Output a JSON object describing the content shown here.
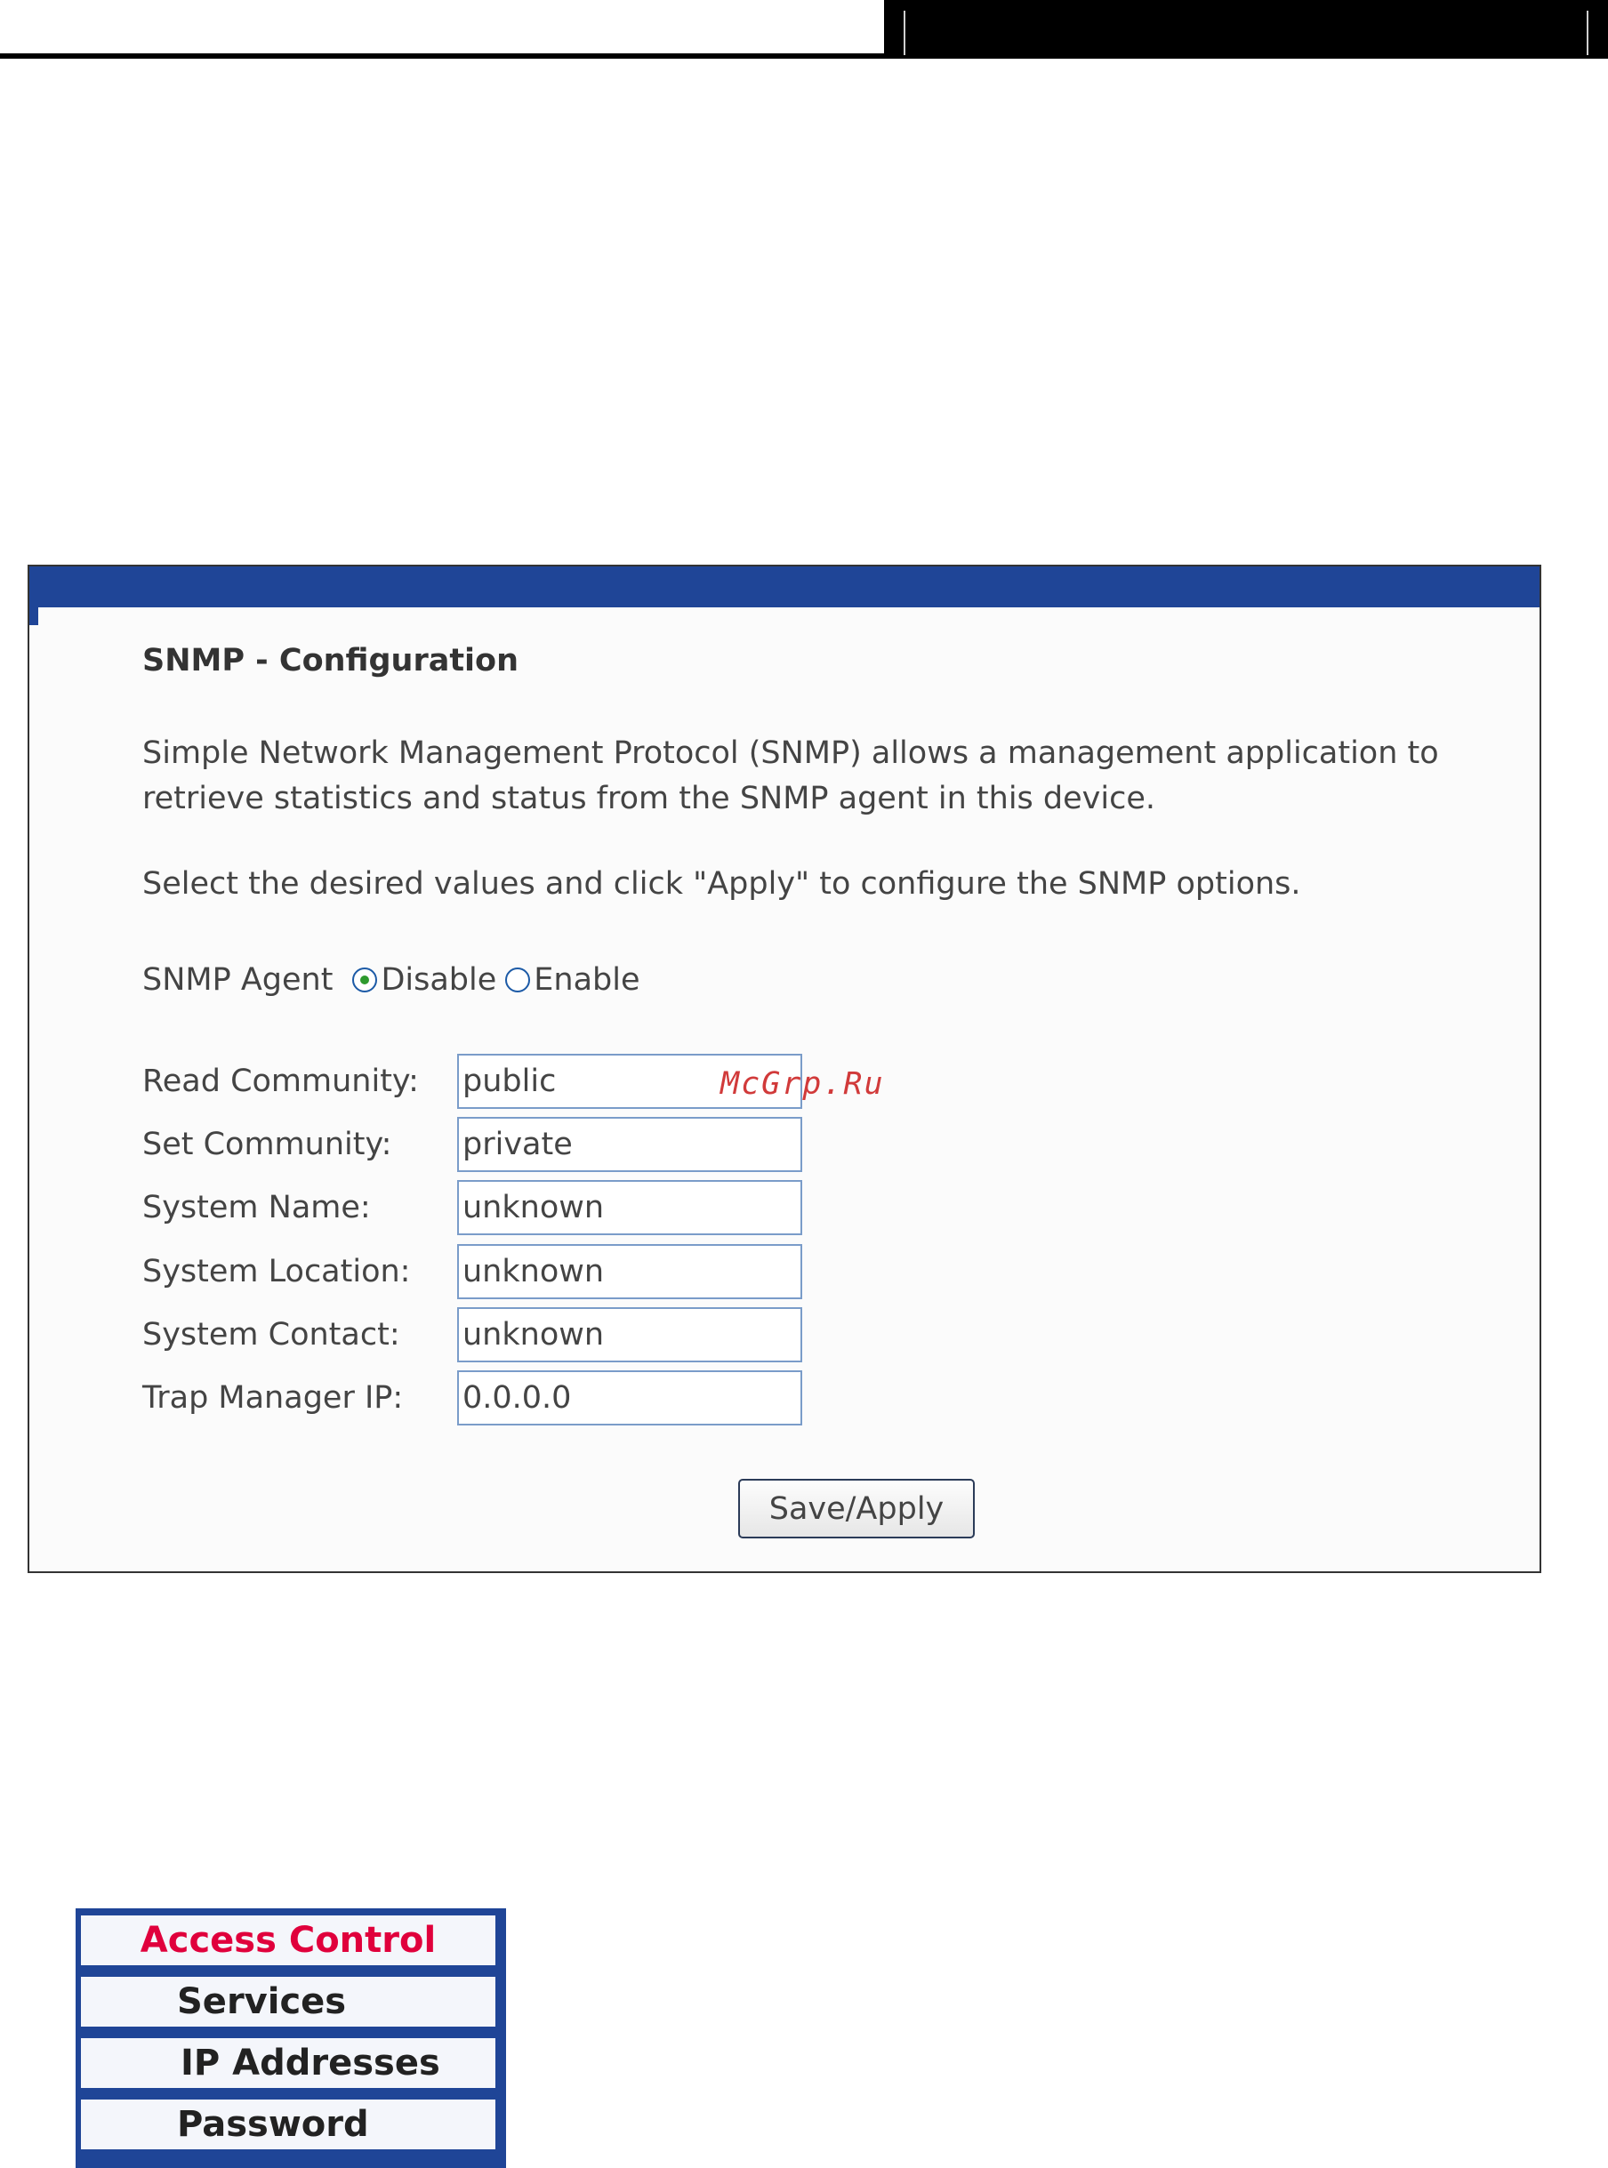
{
  "panel": {
    "title": "SNMP - Configuration",
    "description": "Simple Network Management Protocol (SNMP) allows a management application to retrieve statistics and status from the SNMP agent in this device.",
    "instruction": "Select the desired values and click \"Apply\" to configure the SNMP options.",
    "agent": {
      "label": "SNMP Agent",
      "options": [
        {
          "label": "Disable",
          "selected": true
        },
        {
          "label": "Enable",
          "selected": false
        }
      ]
    },
    "fields": [
      {
        "label": "Read Community:",
        "value": "public"
      },
      {
        "label": "Set Community:",
        "value": "private"
      },
      {
        "label": "System Name:",
        "value": "unknown"
      },
      {
        "label": "System Location:",
        "value": "unknown"
      },
      {
        "label": "System Contact:",
        "value": "unknown"
      },
      {
        "label": "Trap Manager IP:",
        "value": "0.0.0.0"
      }
    ],
    "save_label": "Save/Apply"
  },
  "watermark": "McGrp.Ru",
  "menu": {
    "header": "Access Control",
    "items": [
      "Services",
      "IP Addresses",
      "Password"
    ]
  },
  "colors": {
    "band": "#1f4597",
    "menu_header": "#e0003c",
    "watermark": "#d13a3a"
  }
}
